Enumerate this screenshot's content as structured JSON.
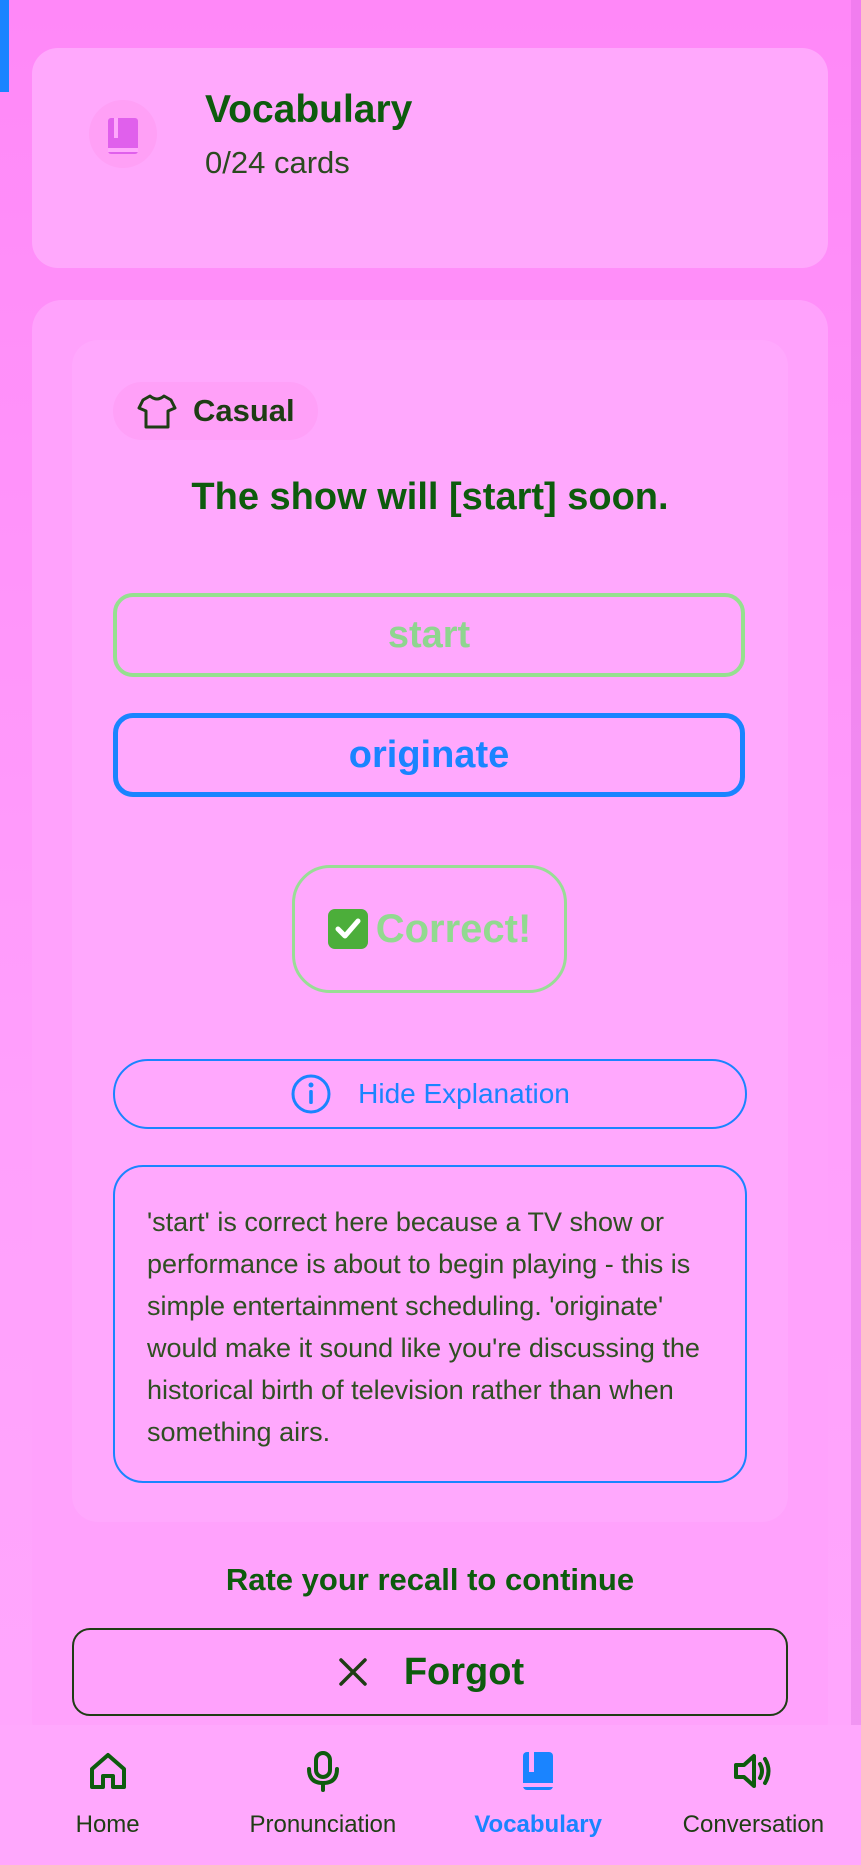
{
  "header": {
    "title": "Vocabulary",
    "subtitle": "0/24 cards",
    "icon": "book-icon"
  },
  "card": {
    "tag": {
      "label": "Casual",
      "icon": "tshirt-icon"
    },
    "prompt": "The show will [start] soon.",
    "options": [
      {
        "label": "start",
        "state": "correct-faded"
      },
      {
        "label": "originate",
        "state": "selected"
      }
    ],
    "feedback": {
      "label": "Correct!",
      "icon": "check-mark-icon"
    },
    "explanation_toggle": {
      "label": "Hide Explanation",
      "icon": "info-icon"
    },
    "explanation": "'start' is correct here because a TV show or performance is about to begin playing - this is simple entertainment scheduling. 'originate' would make it sound like you're discussing the historical birth of television rather than when something airs."
  },
  "rating": {
    "prompt": "Rate your recall to continue",
    "forgot_label": "Forgot",
    "forgot_icon": "close-icon"
  },
  "nav": {
    "items": [
      {
        "label": "Home",
        "icon": "home-icon",
        "active": false
      },
      {
        "label": "Pronunciation",
        "icon": "microphone-icon",
        "active": false
      },
      {
        "label": "Vocabulary",
        "icon": "book-icon",
        "active": true
      },
      {
        "label": "Conversation",
        "icon": "speaker-icon",
        "active": false
      }
    ]
  },
  "colors": {
    "background": "#ff88f8",
    "accent": "#1a84ff",
    "title_green": "#0d5b0d",
    "correct_green": "#95e08f"
  }
}
